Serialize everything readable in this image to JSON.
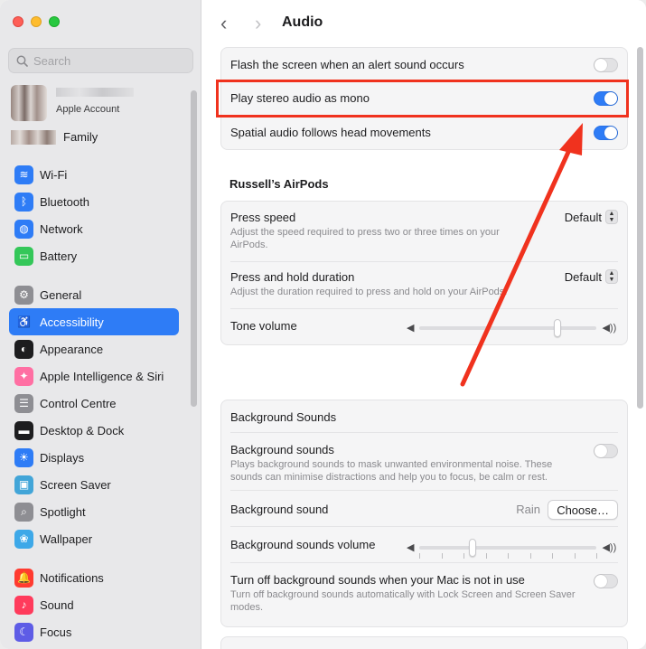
{
  "window": {
    "title": "Audio"
  },
  "search": {
    "placeholder": "Search"
  },
  "account": {
    "label": "Apple Account",
    "family_label": "Family"
  },
  "sidebar": {
    "group1": [
      {
        "label": "Wi‑Fi",
        "icon": "wifi-icon",
        "color": "#2e7cf6"
      },
      {
        "label": "Bluetooth",
        "icon": "bluetooth-icon",
        "color": "#2e7cf6"
      },
      {
        "label": "Network",
        "icon": "globe-icon",
        "color": "#2e7cf6"
      },
      {
        "label": "Battery",
        "icon": "battery-icon",
        "color": "#34c759"
      }
    ],
    "group2": [
      {
        "label": "General",
        "icon": "gear-icon",
        "color": "#8e8e93"
      },
      {
        "label": "Accessibility",
        "icon": "accessibility-icon",
        "color": "#2e7cf6",
        "active": true
      },
      {
        "label": "Appearance",
        "icon": "appearance-icon",
        "color": "#1d1d1f"
      },
      {
        "label": "Apple Intelligence & Siri",
        "icon": "siri-icon",
        "color": "#ff6fa3"
      },
      {
        "label": "Control Centre",
        "icon": "control-centre-icon",
        "color": "#8e8e93"
      },
      {
        "label": "Desktop & Dock",
        "icon": "dock-icon",
        "color": "#1d1d1f"
      },
      {
        "label": "Displays",
        "icon": "sun-icon",
        "color": "#2e7cf6"
      },
      {
        "label": "Screen Saver",
        "icon": "screen-saver-icon",
        "color": "#42a5d8"
      },
      {
        "label": "Spotlight",
        "icon": "magnifier-icon",
        "color": "#8e8e93"
      },
      {
        "label": "Wallpaper",
        "icon": "wallpaper-icon",
        "color": "#3da8e8"
      }
    ],
    "group3": [
      {
        "label": "Notifications",
        "icon": "bell-icon",
        "color": "#ff3b30"
      },
      {
        "label": "Sound",
        "icon": "speaker-icon",
        "color": "#ff3b5c"
      },
      {
        "label": "Focus",
        "icon": "moon-icon",
        "color": "#5e5ce6"
      }
    ]
  },
  "audio": {
    "flash_label": "Flash the screen when an alert sound occurs",
    "flash_on": false,
    "mono_label": "Play stereo audio as mono",
    "mono_on": true,
    "spatial_label": "Spatial audio follows head movements",
    "spatial_on": true
  },
  "airpods": {
    "header": "Russell’s AirPods",
    "press_speed": {
      "label": "Press speed",
      "desc": "Adjust the speed required to press two or three times on your AirPods.",
      "value": "Default"
    },
    "press_hold": {
      "label": "Press and hold duration",
      "desc": "Adjust the duration required to press and hold on your AirPods.",
      "value": "Default"
    },
    "tone_volume": {
      "label": "Tone volume",
      "level": 0.78
    }
  },
  "background_sounds": {
    "header": "Background Sounds",
    "toggle_label": "Background sounds",
    "toggle_desc": "Plays background sounds to mask unwanted environmental noise. These sounds can minimise distractions and help you to focus, be calm or rest.",
    "toggle_on": false,
    "sound_label": "Background sound",
    "sound_value": "Rain",
    "choose_button": "Choose…",
    "volume_label": "Background sounds volume",
    "volume_level": 0.3,
    "turn_off_label": "Turn off background sounds when your Mac is not in use",
    "turn_off_desc": "Turn off background sounds automatically with Lock Screen and Screen Saver modes.",
    "turn_off_on": false
  },
  "annotation": {
    "color": "#f0321e"
  }
}
